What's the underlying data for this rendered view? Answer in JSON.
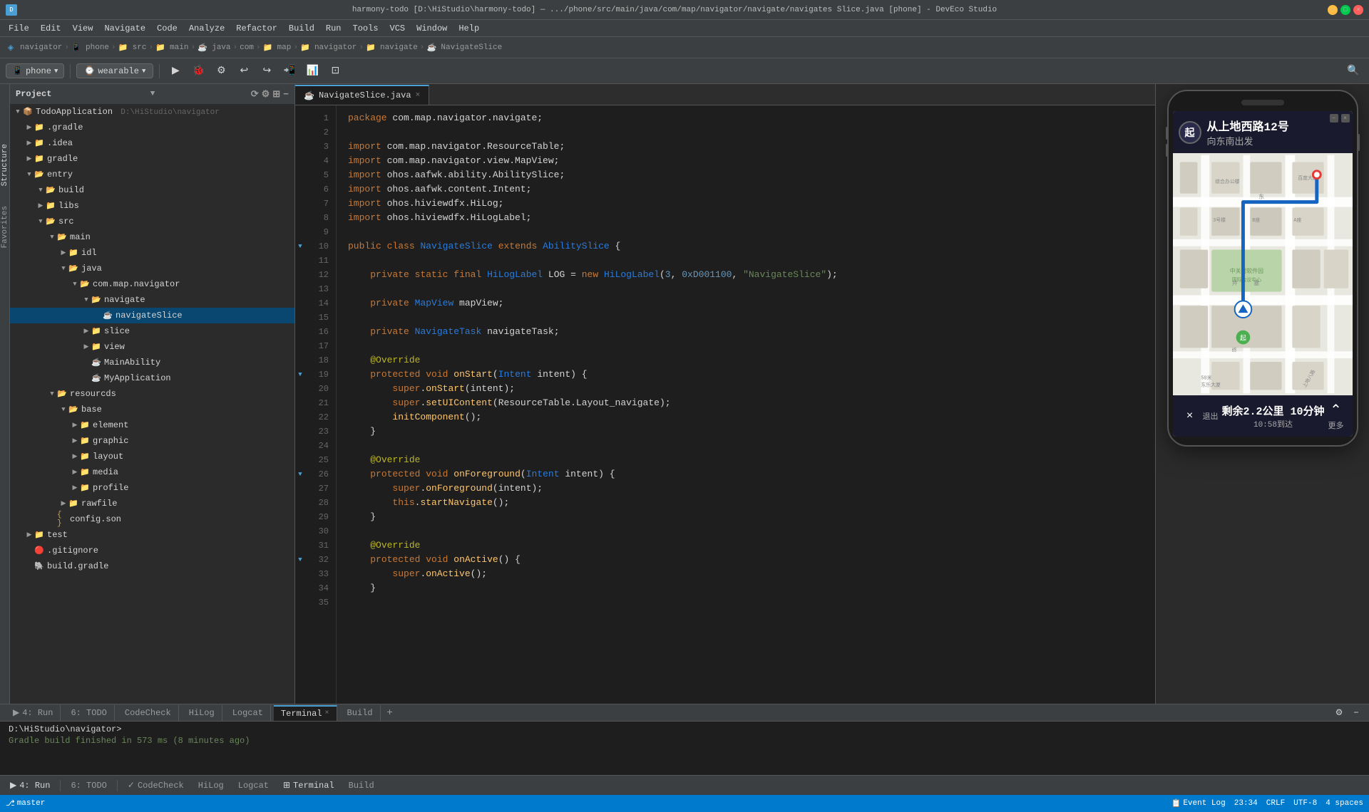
{
  "titleBar": {
    "title": "harmony-todo [D:\\HiStudio\\harmony-todo] — .../phone/src/main/java/com/map/navigator/navigate/navigates Slice.java [phone] - DevEco Studio",
    "minimize": "−",
    "maximize": "□",
    "close": "×"
  },
  "menuBar": {
    "items": [
      "File",
      "Edit",
      "View",
      "Navigate",
      "Code",
      "Analyze",
      "Refactor",
      "Build",
      "Run",
      "Tools",
      "VCS",
      "Window",
      "Help"
    ]
  },
  "breadcrumb": {
    "items": [
      "navigator",
      "phone",
      "src",
      "main",
      "java",
      "com",
      "map",
      "navigator",
      "navigate",
      "NavigateSlice"
    ]
  },
  "toolbar": {
    "deviceLabel": "phone",
    "wearableLabel": "wearable",
    "runLabel": "▶",
    "buildLabel": "🔨"
  },
  "sidebar": {
    "header": "Project",
    "root": "TodoApplication",
    "rootPath": "D:\\HiStudio\\navigator",
    "tree": [
      {
        "label": ".gradle",
        "type": "folder",
        "indent": 1,
        "collapsed": true
      },
      {
        "label": ".idea",
        "type": "folder",
        "indent": 1,
        "collapsed": true
      },
      {
        "label": "gradle",
        "type": "folder",
        "indent": 1,
        "collapsed": true
      },
      {
        "label": "entry",
        "type": "folder",
        "indent": 1,
        "collapsed": false
      },
      {
        "label": "build",
        "type": "folder",
        "indent": 2,
        "collapsed": false
      },
      {
        "label": "libs",
        "type": "folder",
        "indent": 2,
        "collapsed": true
      },
      {
        "label": "src",
        "type": "folder",
        "indent": 2,
        "collapsed": false
      },
      {
        "label": "main",
        "type": "folder",
        "indent": 3,
        "collapsed": false
      },
      {
        "label": "idl",
        "type": "folder",
        "indent": 4,
        "collapsed": true
      },
      {
        "label": "java",
        "type": "folder",
        "indent": 4,
        "collapsed": false
      },
      {
        "label": "com.map.navigator",
        "type": "folder",
        "indent": 5,
        "collapsed": false
      },
      {
        "label": "navigate",
        "type": "folder",
        "indent": 6,
        "collapsed": false
      },
      {
        "label": "navigateSlice",
        "type": "java",
        "indent": 7,
        "selected": true
      },
      {
        "label": "slice",
        "type": "folder",
        "indent": 6,
        "collapsed": true
      },
      {
        "label": "view",
        "type": "folder",
        "indent": 6,
        "collapsed": true
      },
      {
        "label": "MainAbility",
        "type": "java",
        "indent": 6
      },
      {
        "label": "MyApplication",
        "type": "java",
        "indent": 6
      },
      {
        "label": "resourcds",
        "type": "folder",
        "indent": 3,
        "collapsed": false
      },
      {
        "label": "base",
        "type": "folder",
        "indent": 4,
        "collapsed": false
      },
      {
        "label": "element",
        "type": "folder",
        "indent": 5,
        "collapsed": true
      },
      {
        "label": "graphic",
        "type": "folder",
        "indent": 5,
        "collapsed": true
      },
      {
        "label": "layout",
        "type": "folder",
        "indent": 5,
        "collapsed": true
      },
      {
        "label": "media",
        "type": "folder",
        "indent": 5,
        "collapsed": true
      },
      {
        "label": "profile",
        "type": "folder",
        "indent": 5,
        "collapsed": true
      },
      {
        "label": "rawfile",
        "type": "folder",
        "indent": 4,
        "collapsed": true
      },
      {
        "label": "config.son",
        "type": "json",
        "indent": 3
      },
      {
        "label": "test",
        "type": "folder",
        "indent": 1,
        "collapsed": true
      },
      {
        "label": ".gitignore",
        "type": "git",
        "indent": 1
      },
      {
        "label": "build.gradle",
        "type": "gradle",
        "indent": 1
      }
    ]
  },
  "editor": {
    "filename": "NavigateSlice.java",
    "code": [
      "package com.map.navigator.navigate;",
      "",
      "import com.map.navigator.ResourceTable;",
      "import com.map.navigator.view.MapView;",
      "import ohos.aafwk.ability.AbilitySlice;",
      "import ohos.aafwk.content.Intent;",
      "import ohos.hiviewdfx.HiLog;",
      "import ohos.hiviewdfx.HiLogLabel;",
      "",
      "public class NavigateSlice extends AbilitySlice {",
      "",
      "    private static final HiLogLabel LOG = new HiLogLabel(3, 0xD001100, \"NavigateSlice\");",
      "",
      "    private MapView mapView;",
      "",
      "    private NavigateTask navigateTask;",
      "",
      "    @Override",
      "    protected void onStart(Intent intent) {",
      "        super.onStart(intent);",
      "        super.setUIContent(ResourceTable.Layout_navigate);",
      "        initComponent();",
      "    }",
      "",
      "    @Override",
      "    protected void onForeground(Intent intent) {",
      "        super.onForeground(intent);",
      "        this.startNavigate();",
      "    }",
      "",
      "    @Override",
      "    protected void onActive() {",
      "        super.onActive();",
      "    }",
      ""
    ],
    "lineStart": 1
  },
  "phonePreview": {
    "navHeader": {
      "startChar": "起",
      "street": "从上地西路12号",
      "direction": "向东南出发"
    },
    "navFooter": {
      "closeIcon": "×",
      "exitLabel": "退出",
      "distanceMain": "剩余2.2公里 10分钟",
      "distanceSub": "10:58到达",
      "moreIcon": "⌃",
      "moreLabel": "更多"
    }
  },
  "terminal": {
    "tabs": [
      {
        "label": "4: Run",
        "icon": "▶"
      },
      {
        "label": "6: TODO"
      },
      {
        "label": "CodeCheck"
      },
      {
        "label": "HiLog"
      },
      {
        "label": "Logcat"
      },
      {
        "label": "Terminal",
        "active": true
      },
      {
        "label": "Build"
      }
    ],
    "cwd": "D:\\HiStudio\\navigator>",
    "status": "Gradle build finished in 573 ms (8 minutes ago)"
  },
  "statusBar": {
    "time": "23:34",
    "encoding": "UTF-8",
    "lineEnding": "CRLF",
    "spaces": "4 spaces",
    "eventLog": "Event Log",
    "branch": "master"
  },
  "verticalTabs": {
    "structure": "Structure",
    "favorites": "Favorites"
  }
}
